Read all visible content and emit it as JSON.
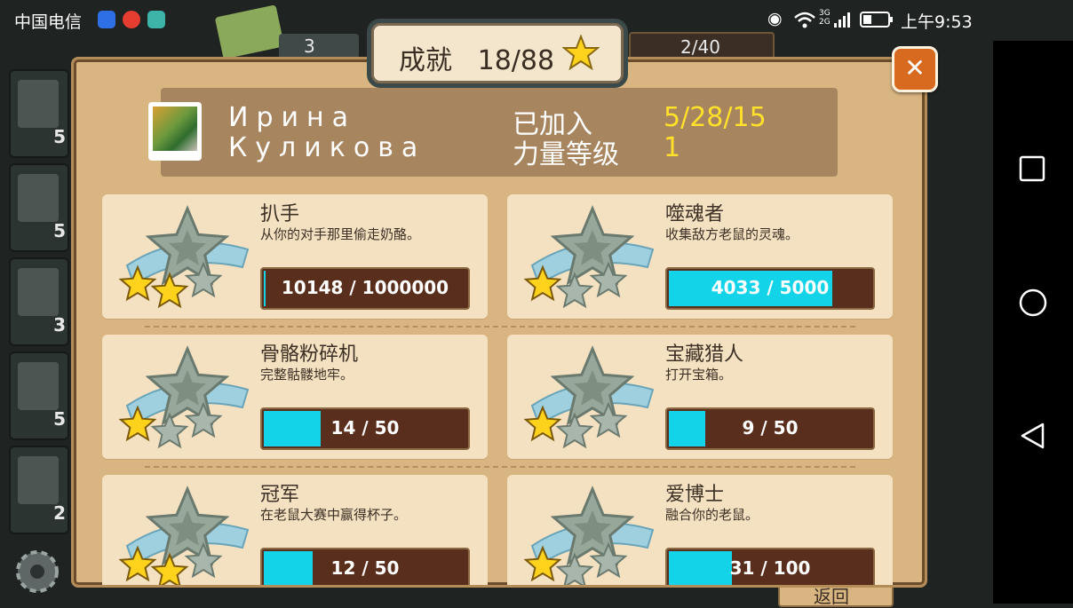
{
  "status": {
    "carrier": "中国电信",
    "network": "3G 2G",
    "time": "上午9:53",
    "icons": [
      "baidu-icon",
      "weibo-icon",
      "play-icon",
      "eye-icon",
      "wifi-icon",
      "signal-icon",
      "battery-icon"
    ]
  },
  "background": {
    "slot_counts": [
      "5",
      "5",
      "3",
      "5",
      "2"
    ],
    "top_count": "3",
    "top_right_count": "2/40",
    "back_label": "返回"
  },
  "panel": {
    "title": "成就",
    "progress": "18/88",
    "profile": {
      "name_line1": "Ирина",
      "name_line2": "Куликова",
      "joined_label": "已加入",
      "joined_value": "5/28/15",
      "power_label": "力量等级",
      "power_value": "1"
    },
    "achievements": [
      {
        "title": "扒手",
        "desc": "从你的对手那里偷走奶酪。",
        "progress_text": "10148 / 1000000",
        "fraction": 0.010148,
        "gold_stars": 2
      },
      {
        "title": "噬魂者",
        "desc": "收集敌方老鼠的灵魂。",
        "progress_text": "4033 / 5000",
        "fraction": 0.8066,
        "gold_stars": 1
      },
      {
        "title": "骨骼粉碎机",
        "desc": "完整骷髅地牢。",
        "progress_text": "14 / 50",
        "fraction": 0.28,
        "gold_stars": 1
      },
      {
        "title": "宝藏猎人",
        "desc": "打开宝箱。",
        "progress_text": "9 / 50",
        "fraction": 0.18,
        "gold_stars": 1
      },
      {
        "title": "冠军",
        "desc": "在老鼠大赛中赢得杯子。",
        "progress_text": "12 / 50",
        "fraction": 0.24,
        "gold_stars": 2
      },
      {
        "title": "爱博士",
        "desc": "融合你的老鼠。",
        "progress_text": "31 / 100",
        "fraction": 0.31,
        "gold_stars": 1
      }
    ]
  },
  "colors": {
    "panel": "#d9b582",
    "card": "#f4e1c2",
    "bar_fill": "#12d3e8",
    "bar_bg": "#5a2e1c",
    "gold": "#ffe02a"
  }
}
